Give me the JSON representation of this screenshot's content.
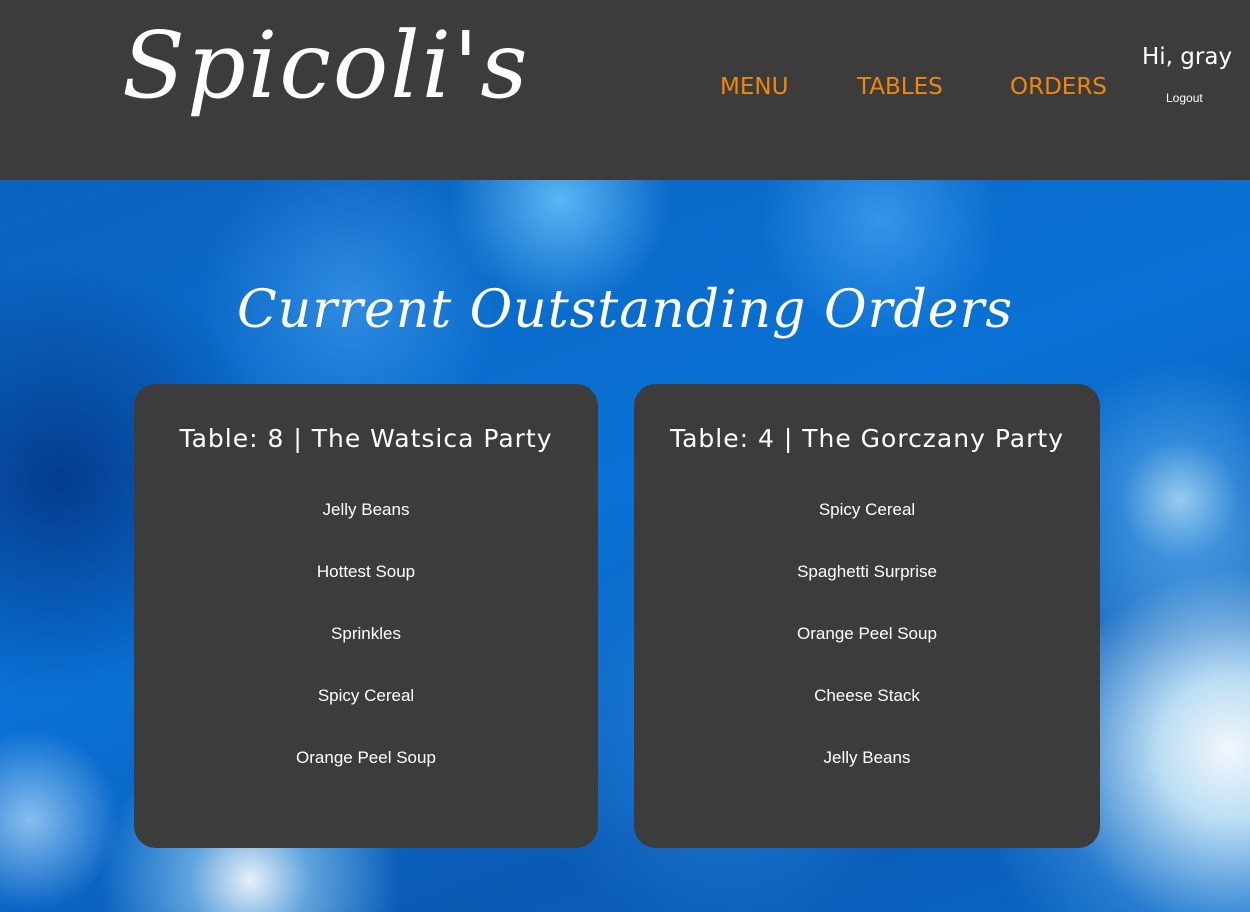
{
  "header": {
    "logo": "Spicoli's",
    "nav": [
      {
        "label": "MENU"
      },
      {
        "label": "TABLES"
      },
      {
        "label": "ORDERS"
      }
    ],
    "greeting": "Hi, gray",
    "logout_label": "Logout"
  },
  "main": {
    "title": "Current Outstanding Orders",
    "orders": [
      {
        "title": "Table: 8 | The Watsica Party",
        "items": [
          "Jelly Beans",
          "Hottest Soup",
          "Sprinkles",
          "Spicy Cereal",
          "Orange Peel Soup"
        ]
      },
      {
        "title": "Table: 4 | The Gorczany Party",
        "items": [
          "Spicy Cereal",
          "Spaghetti Surprise",
          "Orange Peel Soup",
          "Cheese Stack",
          "Jelly Beans"
        ]
      }
    ]
  },
  "colors": {
    "header_bg": "#3c3c3c",
    "nav_accent": "#f0860e",
    "card_bg": "#3c3c3c",
    "background_blue": "#0a6ecf"
  }
}
